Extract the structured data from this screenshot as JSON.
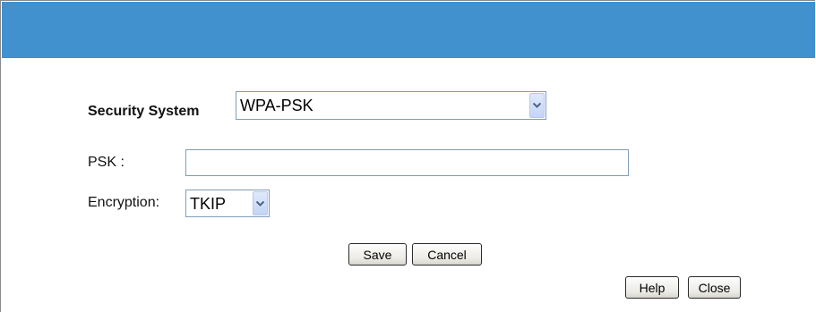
{
  "form": {
    "security_system": {
      "label": "Security System",
      "selected": "WPA-PSK"
    },
    "psk": {
      "label": "PSK :",
      "value": ""
    },
    "encryption": {
      "label": "Encryption:",
      "selected": "TKIP"
    }
  },
  "buttons": {
    "save": "Save",
    "cancel": "Cancel",
    "help": "Help",
    "close": "Close"
  },
  "colors": {
    "header_bar": "#4191cf",
    "field_border": "#7f9db9"
  },
  "icons": {
    "dropdown": "chevron-down-icon"
  }
}
